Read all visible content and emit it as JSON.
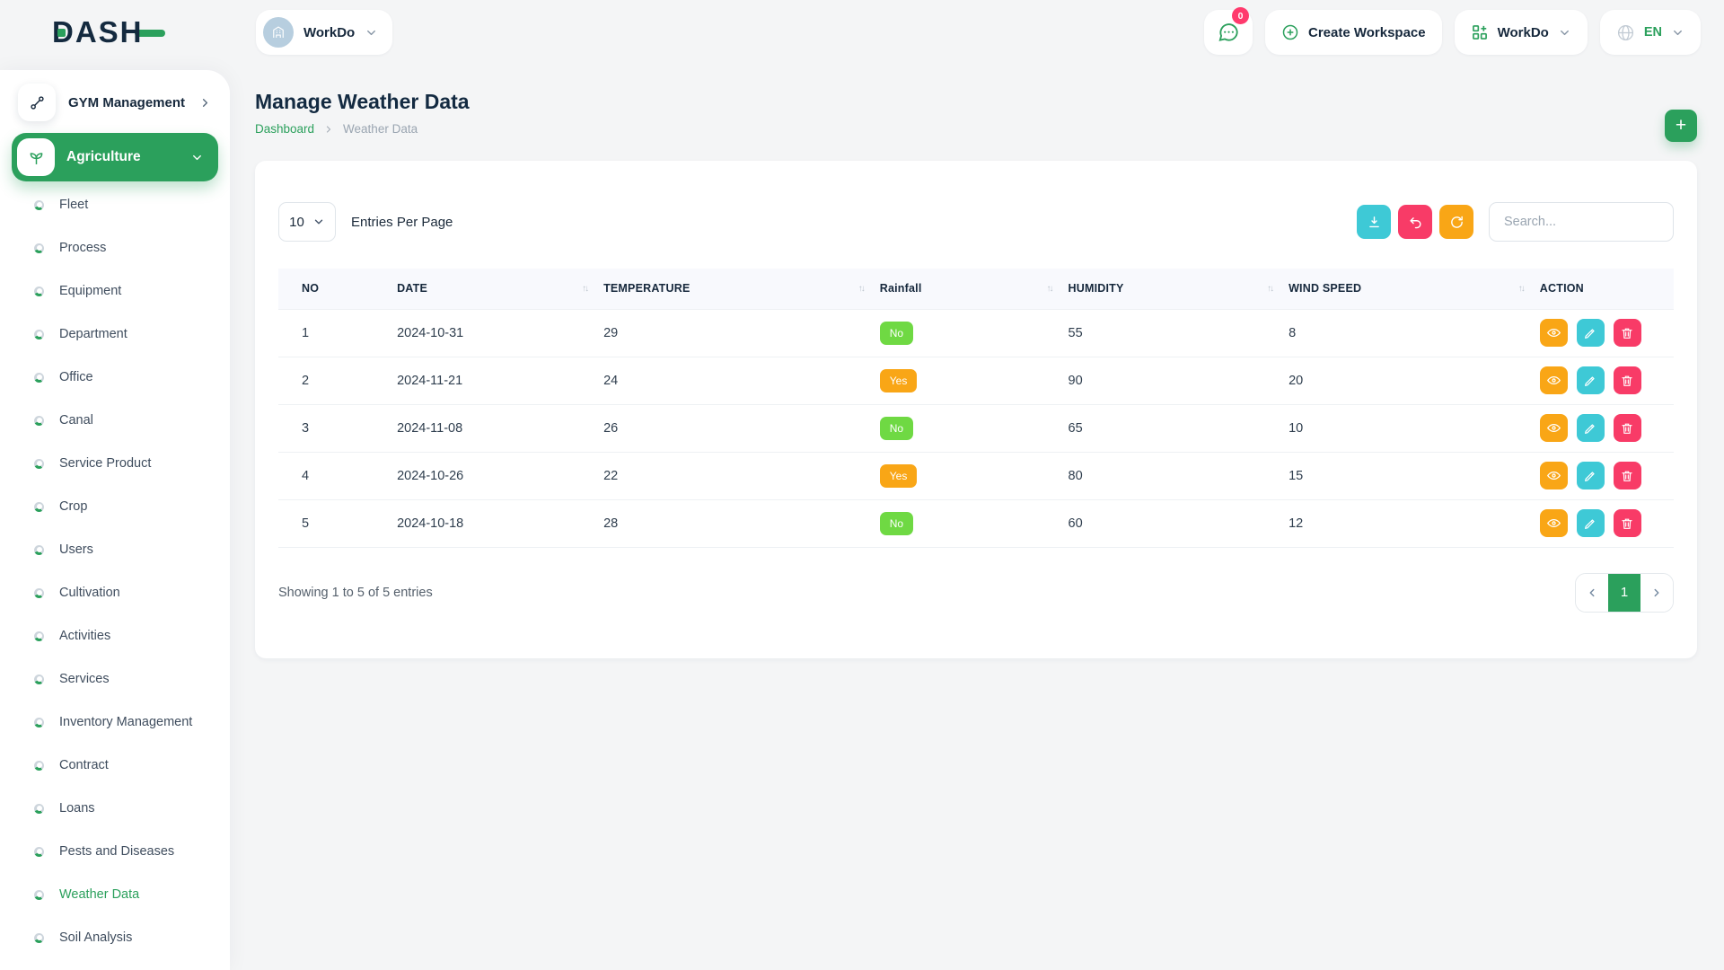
{
  "brand": {
    "logo_text": "DASH"
  },
  "topbar": {
    "workspace_switcher": {
      "label": "WorkDo"
    },
    "messages": {
      "count": "0"
    },
    "create_workspace": {
      "label": "Create Workspace"
    },
    "workdo_menu": {
      "label": "WorkDo"
    },
    "language": {
      "code": "EN"
    }
  },
  "sidebar": {
    "gym_management_label": "GYM Management",
    "active_module_label": "Agriculture",
    "items": [
      {
        "label": "Fleet"
      },
      {
        "label": "Process"
      },
      {
        "label": "Equipment"
      },
      {
        "label": "Department"
      },
      {
        "label": "Office"
      },
      {
        "label": "Canal"
      },
      {
        "label": "Service Product"
      },
      {
        "label": "Crop"
      },
      {
        "label": "Users"
      },
      {
        "label": "Cultivation"
      },
      {
        "label": "Activities"
      },
      {
        "label": "Services"
      },
      {
        "label": "Inventory Management"
      },
      {
        "label": "Contract"
      },
      {
        "label": "Loans"
      },
      {
        "label": "Pests and Diseases"
      },
      {
        "label": "Weather Data",
        "active": true
      },
      {
        "label": "Soil Analysis"
      }
    ]
  },
  "page": {
    "title": "Manage Weather Data",
    "breadcrumb": {
      "root": "Dashboard",
      "current": "Weather Data"
    },
    "add_button_label": "+"
  },
  "toolbar": {
    "entries_per_page_value": "10",
    "entries_per_page_label": "Entries Per Page",
    "buttons": [
      "download",
      "undo",
      "refresh"
    ],
    "search_placeholder": "Search..."
  },
  "table": {
    "columns": [
      {
        "label": "NO",
        "sortable": false
      },
      {
        "label": "DATE",
        "sortable": true
      },
      {
        "label": "TEMPERATURE",
        "sortable": true
      },
      {
        "label": "Rainfall",
        "sortable": true
      },
      {
        "label": "HUMIDITY",
        "sortable": true
      },
      {
        "label": "WIND SPEED",
        "sortable": true
      },
      {
        "label": "ACTION",
        "sortable": false
      }
    ],
    "rows": [
      {
        "no": "1",
        "date": "2024-10-31",
        "temperature": "29",
        "rainfall": "No",
        "humidity": "55",
        "wind_speed": "8"
      },
      {
        "no": "2",
        "date": "2024-11-21",
        "temperature": "24",
        "rainfall": "Yes",
        "humidity": "90",
        "wind_speed": "20"
      },
      {
        "no": "3",
        "date": "2024-11-08",
        "temperature": "26",
        "rainfall": "No",
        "humidity": "65",
        "wind_speed": "10"
      },
      {
        "no": "4",
        "date": "2024-10-26",
        "temperature": "22",
        "rainfall": "Yes",
        "humidity": "80",
        "wind_speed": "15"
      },
      {
        "no": "5",
        "date": "2024-10-18",
        "temperature": "28",
        "rainfall": "No",
        "humidity": "60",
        "wind_speed": "12"
      }
    ]
  },
  "footer": {
    "summary": "Showing 1 to 5 of 5 entries",
    "pagination": {
      "current_page": "1"
    }
  },
  "colors": {
    "primary_green": "#2ba05c",
    "badge_green": "#6fd943",
    "orange": "#f9a616",
    "cyan": "#3ec9d6",
    "pink": "#f83b67"
  }
}
